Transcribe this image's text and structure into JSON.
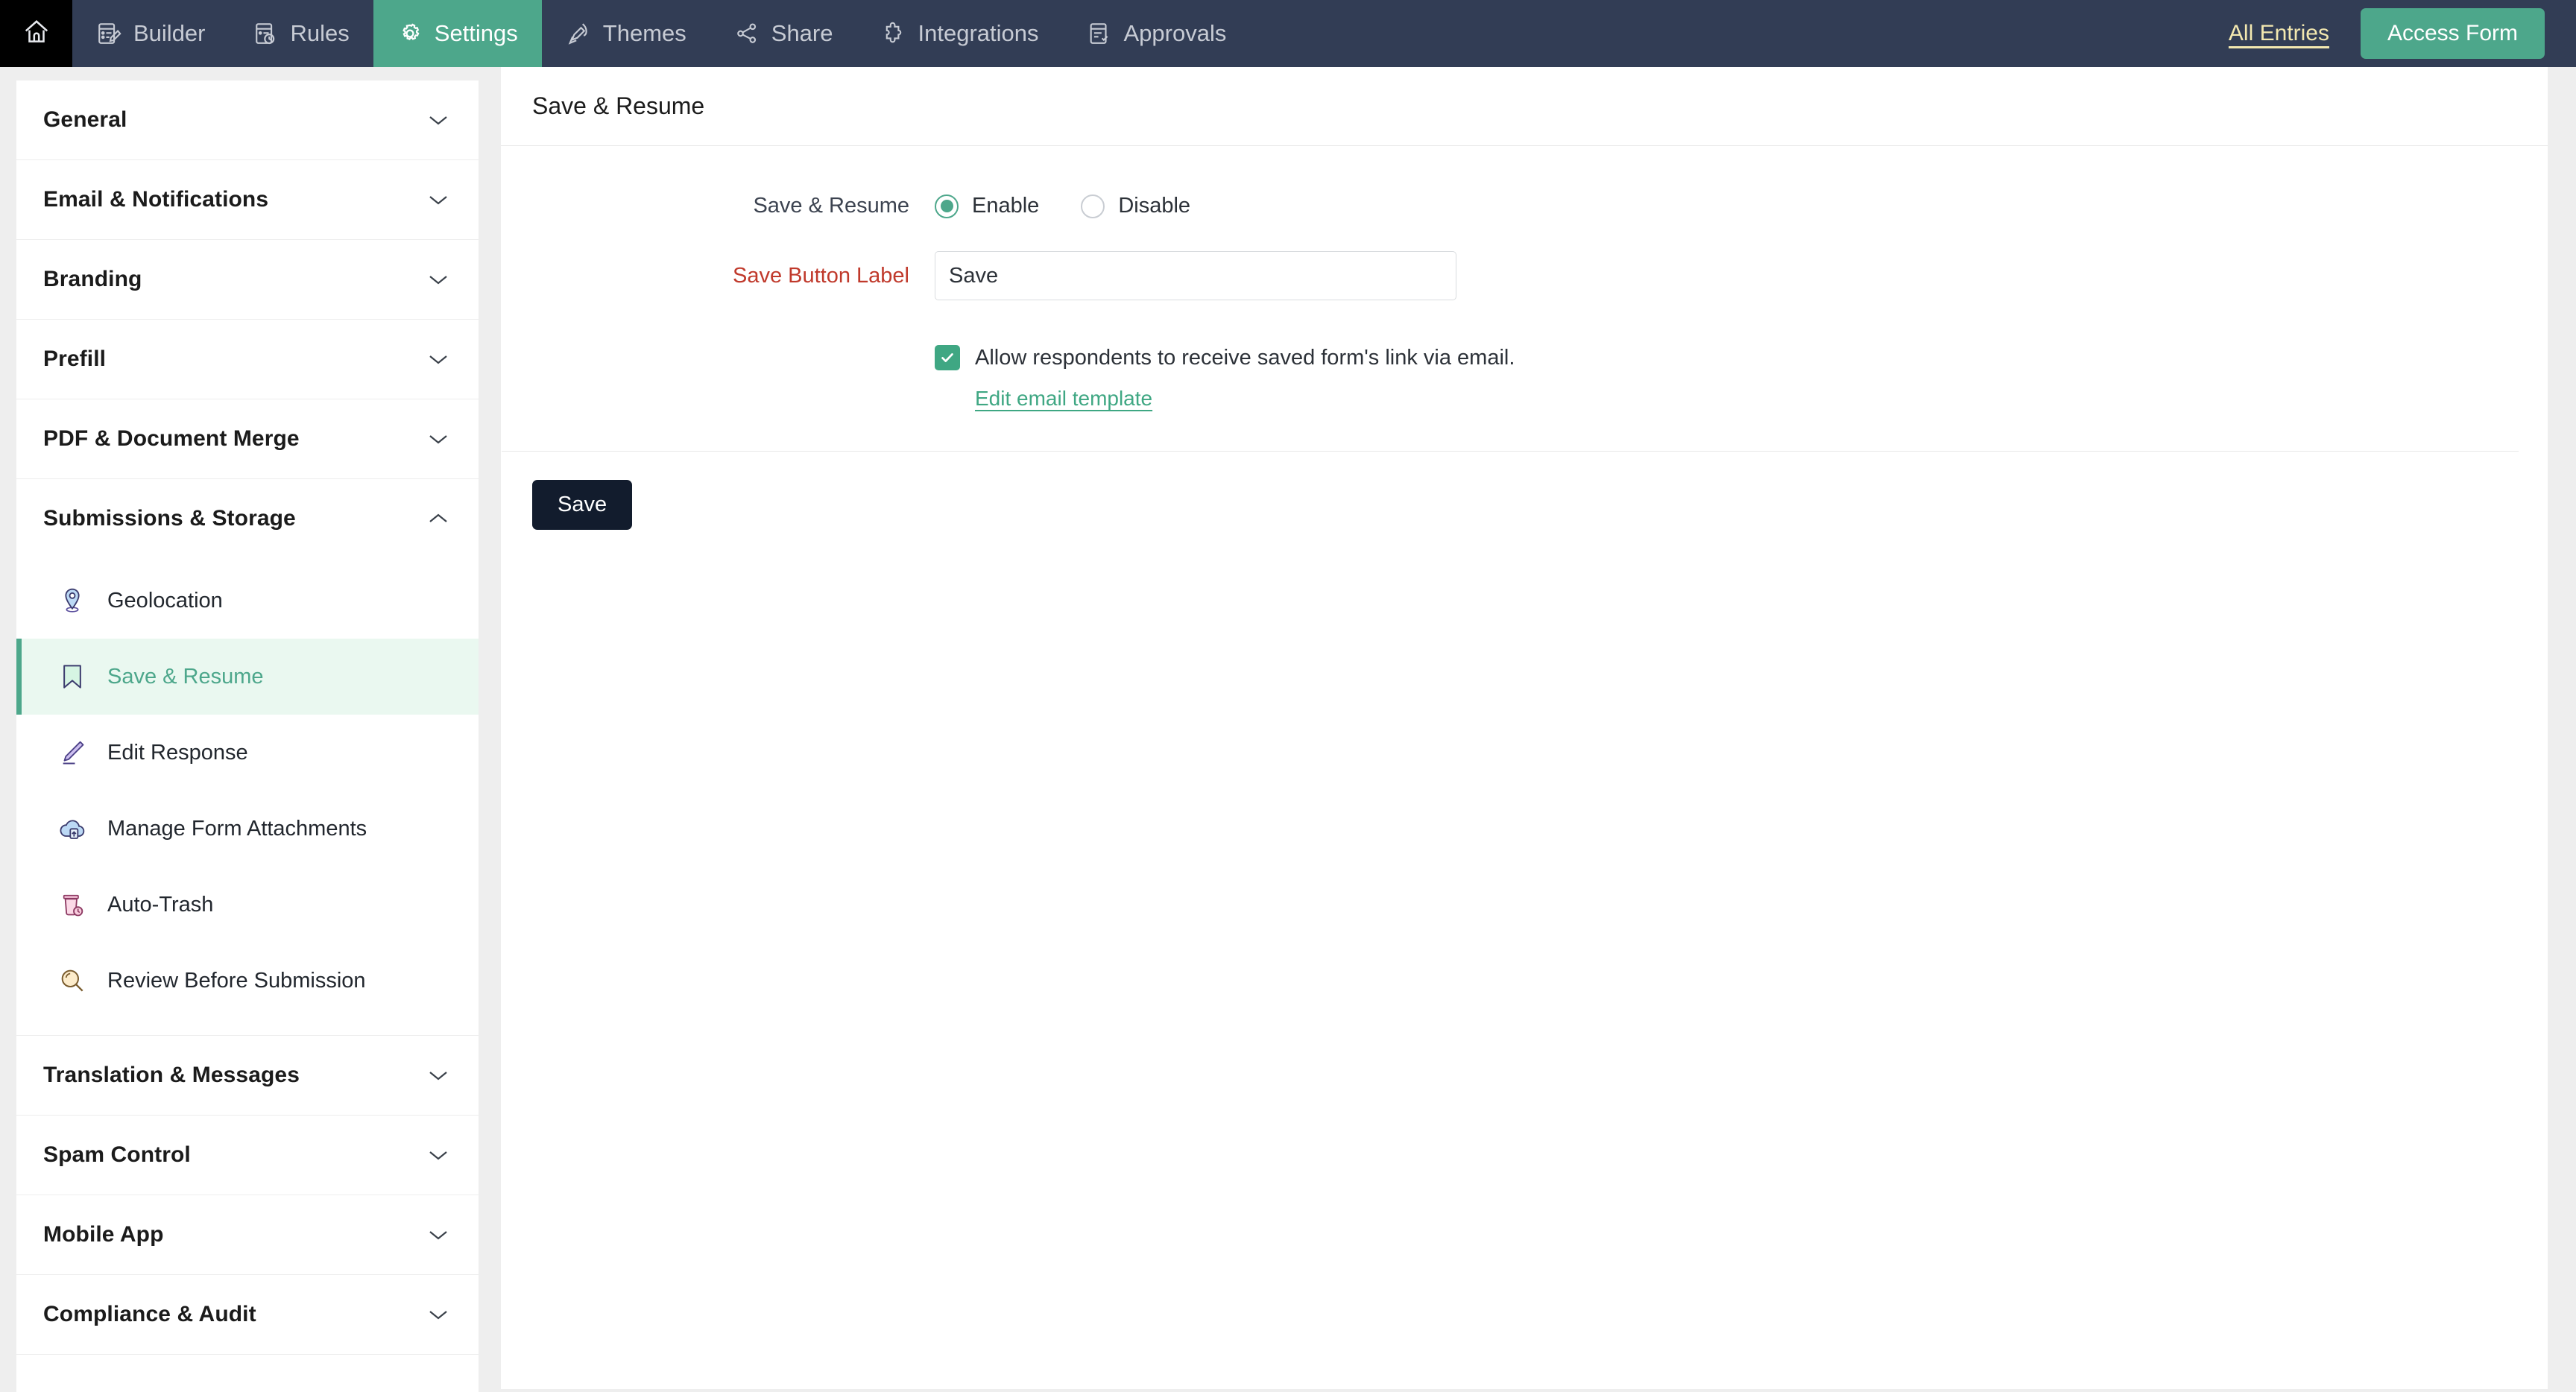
{
  "topnav": {
    "home_icon": "home-icon",
    "tabs": [
      {
        "label": "Builder",
        "icon": "form-builder-icon",
        "active": false
      },
      {
        "label": "Rules",
        "icon": "rules-icon",
        "active": false
      },
      {
        "label": "Settings",
        "icon": "gear-icon",
        "active": true
      },
      {
        "label": "Themes",
        "icon": "brush-icon",
        "active": false
      },
      {
        "label": "Share",
        "icon": "share-nodes-icon",
        "active": false
      },
      {
        "label": "Integrations",
        "icon": "puzzle-icon",
        "active": false
      },
      {
        "label": "Approvals",
        "icon": "approvals-icon",
        "active": false
      }
    ],
    "all_entries_label": "All Entries",
    "access_form_label": "Access Form",
    "bg_color": "#323d55",
    "accent_color": "#4da78b",
    "link_color": "#f3e8b0"
  },
  "sidebar": {
    "groups": [
      {
        "label": "General",
        "expanded": false
      },
      {
        "label": "Email & Notifications",
        "expanded": false
      },
      {
        "label": "Branding",
        "expanded": false
      },
      {
        "label": "Prefill",
        "expanded": false
      },
      {
        "label": "PDF & Document Merge",
        "expanded": false
      },
      {
        "label": "Submissions & Storage",
        "expanded": true,
        "items": [
          {
            "label": "Geolocation",
            "icon": "map-pin-icon",
            "active": false
          },
          {
            "label": "Save & Resume",
            "icon": "bookmark-icon",
            "active": true
          },
          {
            "label": "Edit Response",
            "icon": "pencil-icon",
            "active": false
          },
          {
            "label": "Manage Form Attachments",
            "icon": "cloud-upload-icon",
            "active": false
          },
          {
            "label": "Auto-Trash",
            "icon": "trash-clock-icon",
            "active": false
          },
          {
            "label": "Review Before Submission",
            "icon": "magnifier-icon",
            "active": false
          }
        ]
      },
      {
        "label": "Translation & Messages",
        "expanded": false
      },
      {
        "label": "Spam Control",
        "expanded": false
      },
      {
        "label": "Mobile App",
        "expanded": false
      },
      {
        "label": "Compliance & Audit",
        "expanded": false
      }
    ],
    "active_color": "#4da78b",
    "active_bg": "#eaf8f0"
  },
  "main": {
    "title": "Save & Resume",
    "save_resume": {
      "label": "Save & Resume",
      "options": [
        {
          "label": "Enable",
          "selected": true
        },
        {
          "label": "Disable",
          "selected": false
        }
      ]
    },
    "save_button_label": {
      "label": "Save Button Label",
      "required": true,
      "value": "Save",
      "placeholder": "Save"
    },
    "allow_email": {
      "checked": true,
      "label": "Allow respondents to receive saved form's link via email.",
      "edit_link_label": "Edit email template"
    },
    "submit_label": "Save",
    "required_label_color": "#c0392b",
    "submit_bg": "#121c2d"
  }
}
